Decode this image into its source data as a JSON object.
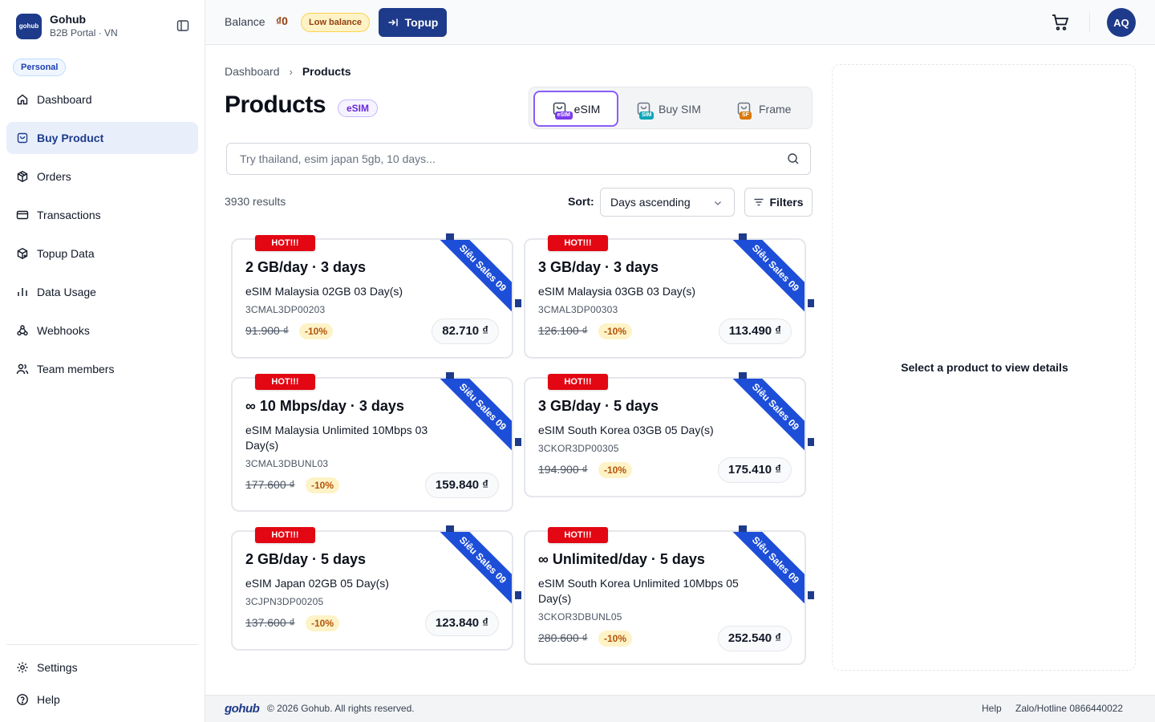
{
  "brand": {
    "logo_text": "gohub",
    "name": "Gohub",
    "subtitle": "B2B Portal · VN",
    "account_badge": "Personal"
  },
  "sidebar": {
    "items": [
      {
        "label": "Dashboard",
        "icon": "home-icon"
      },
      {
        "label": "Buy Product",
        "icon": "shopping-bag-icon",
        "active": true
      },
      {
        "label": "Orders",
        "icon": "package-icon"
      },
      {
        "label": "Transactions",
        "icon": "credit-card-icon"
      },
      {
        "label": "Topup Data",
        "icon": "package-plus-icon"
      },
      {
        "label": "Data Usage",
        "icon": "bar-chart-icon"
      },
      {
        "label": "Webhooks",
        "icon": "webhook-icon"
      },
      {
        "label": "Team members",
        "icon": "users-icon"
      }
    ],
    "bottom_items": [
      {
        "label": "Settings",
        "icon": "gear-icon"
      },
      {
        "label": "Help",
        "icon": "help-circle-icon"
      }
    ]
  },
  "header": {
    "balance_label": "Balance",
    "balance_value": "₫0",
    "low_balance_badge": "Low balance",
    "topup_label": "Topup",
    "avatar_initials": "AQ"
  },
  "breadcrumb": {
    "home": "Dashboard",
    "current": "Products"
  },
  "page": {
    "title": "Products",
    "type_badge": "eSIM"
  },
  "type_tabs": [
    {
      "label": "eSIM",
      "mini": "eSIM",
      "color": "#7c3aed",
      "active": true
    },
    {
      "label": "Buy SIM",
      "mini": "SIM",
      "color": "#0ea5b7",
      "active": false
    },
    {
      "label": "Frame",
      "mini": "SF",
      "color": "#d97706",
      "active": false
    }
  ],
  "search": {
    "placeholder": "Try thailand, esim japan 5gb, 10 days...",
    "value": ""
  },
  "results": {
    "count_text": "3930 results"
  },
  "sort": {
    "label": "Sort:",
    "selected": "Days ascending"
  },
  "filters": {
    "label": "Filters"
  },
  "products": [
    {
      "hot": "HOT!!!",
      "ribbon": "Siêu Sales 09",
      "title": "2 GB/day · 3 days",
      "name": "eSIM Malaysia 02GB 03 Day(s)",
      "sku": "3CMAL3DP00203",
      "old_price": "91.900 ₫",
      "discount": "-10%",
      "price": "82.710 ₫"
    },
    {
      "hot": "HOT!!!",
      "ribbon": "Siêu Sales 09",
      "title": "3 GB/day · 3 days",
      "name": "eSIM Malaysia 03GB 03 Day(s)",
      "sku": "3CMAL3DP00303",
      "old_price": "126.100 ₫",
      "discount": "-10%",
      "price": "113.490 ₫"
    },
    {
      "hot": "HOT!!!",
      "ribbon": "Siêu Sales 09",
      "title": "∞ 10 Mbps/day · 3 days",
      "name": "eSIM Malaysia Unlimited 10Mbps 03 Day(s)",
      "sku": "3CMAL3DBUNL03",
      "old_price": "177.600 ₫",
      "discount": "-10%",
      "price": "159.840 ₫"
    },
    {
      "hot": "HOT!!!",
      "ribbon": "Siêu Sales 09",
      "title": "3 GB/day · 5 days",
      "name": "eSIM South Korea 03GB 05 Day(s)",
      "sku": "3CKOR3DP00305",
      "old_price": "194.900 ₫",
      "discount": "-10%",
      "price": "175.410 ₫"
    },
    {
      "hot": "HOT!!!",
      "ribbon": "Siêu Sales 09",
      "title": "2 GB/day · 5 days",
      "name": "eSIM Japan 02GB 05 Day(s)",
      "sku": "3CJPN3DP00205",
      "old_price": "137.600 ₫",
      "discount": "-10%",
      "price": "123.840 ₫"
    },
    {
      "hot": "HOT!!!",
      "ribbon": "Siêu Sales 09",
      "title": "∞ Unlimited/day · 5 days",
      "name": "eSIM South Korea Unlimited 10Mbps 05 Day(s)",
      "sku": "3CKOR3DBUNL05",
      "old_price": "280.600 ₫",
      "discount": "-10%",
      "price": "252.540 ₫"
    }
  ],
  "detail": {
    "empty_text": "Select a product to view details"
  },
  "footer": {
    "logo_text": "gohub",
    "copyright": "© 2026 Gohub. All rights reserved.",
    "help": "Help",
    "hotline": "Zalo/Hotline 0866440022"
  },
  "colors": {
    "primary": "#1e3a8a",
    "hot_red": "#e30613",
    "ribbon_blue": "#1d4ed8",
    "accent_purple": "#8b5cf6"
  }
}
